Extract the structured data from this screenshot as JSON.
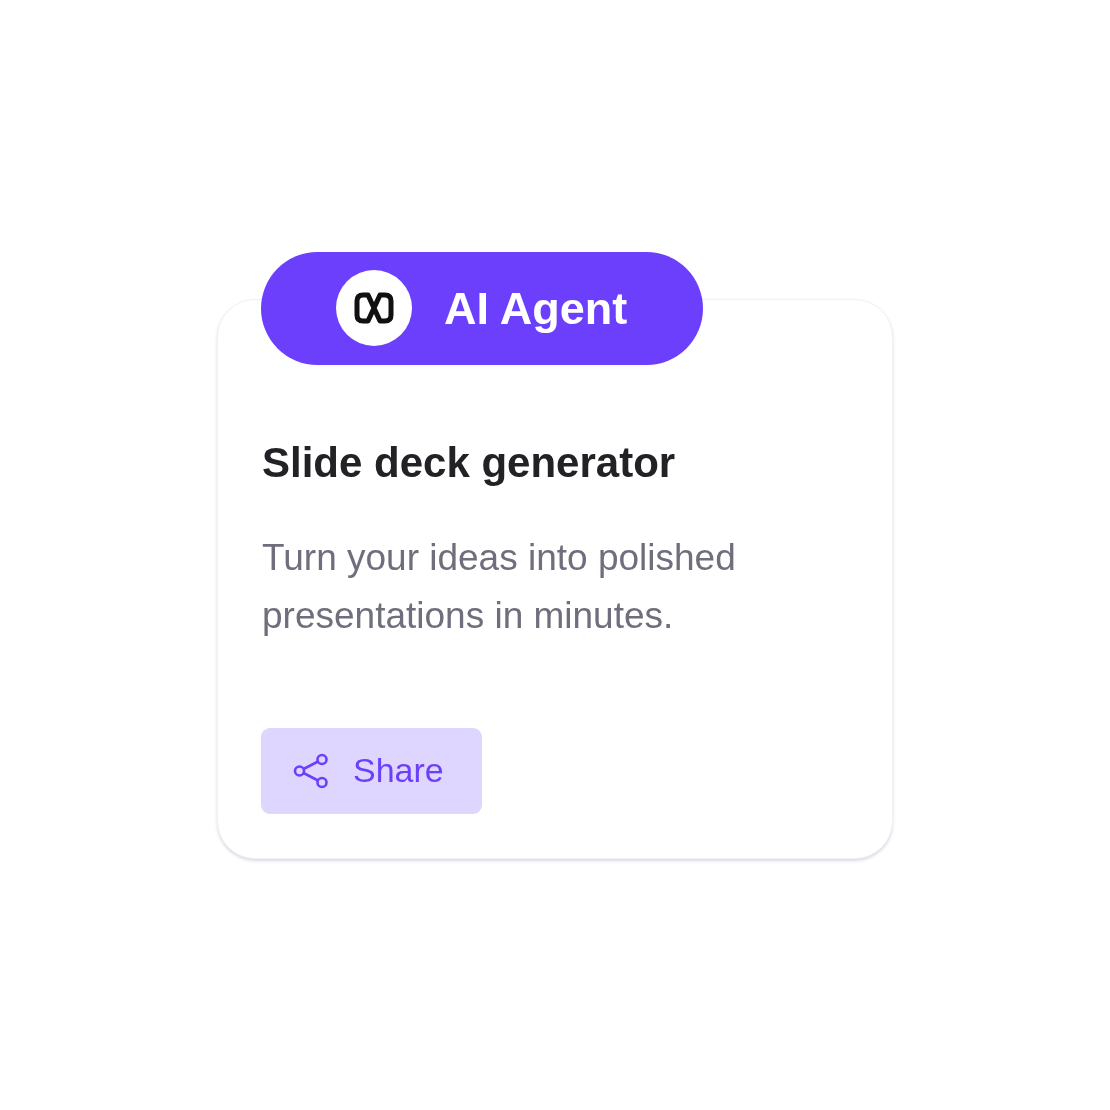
{
  "badge": {
    "label": "AI Agent"
  },
  "card": {
    "title": "Slide deck generator",
    "description": "Turn your ideas into polished presentations in minutes."
  },
  "share_button": {
    "label": "Share"
  }
}
